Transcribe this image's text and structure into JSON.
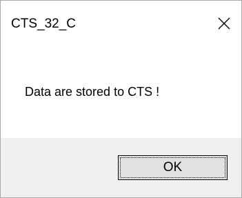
{
  "window": {
    "title": "CTS_32_C",
    "close_icon": "close-icon"
  },
  "dialog": {
    "message": "Data are stored to CTS !"
  },
  "buttons": {
    "ok_label": "OK"
  },
  "colors": {
    "title_background": "#ffffff",
    "content_background": "#ffffff",
    "button_bar_background": "#f0f0f0",
    "button_face": "#e1e1e1",
    "border": "#a9a9a9"
  }
}
